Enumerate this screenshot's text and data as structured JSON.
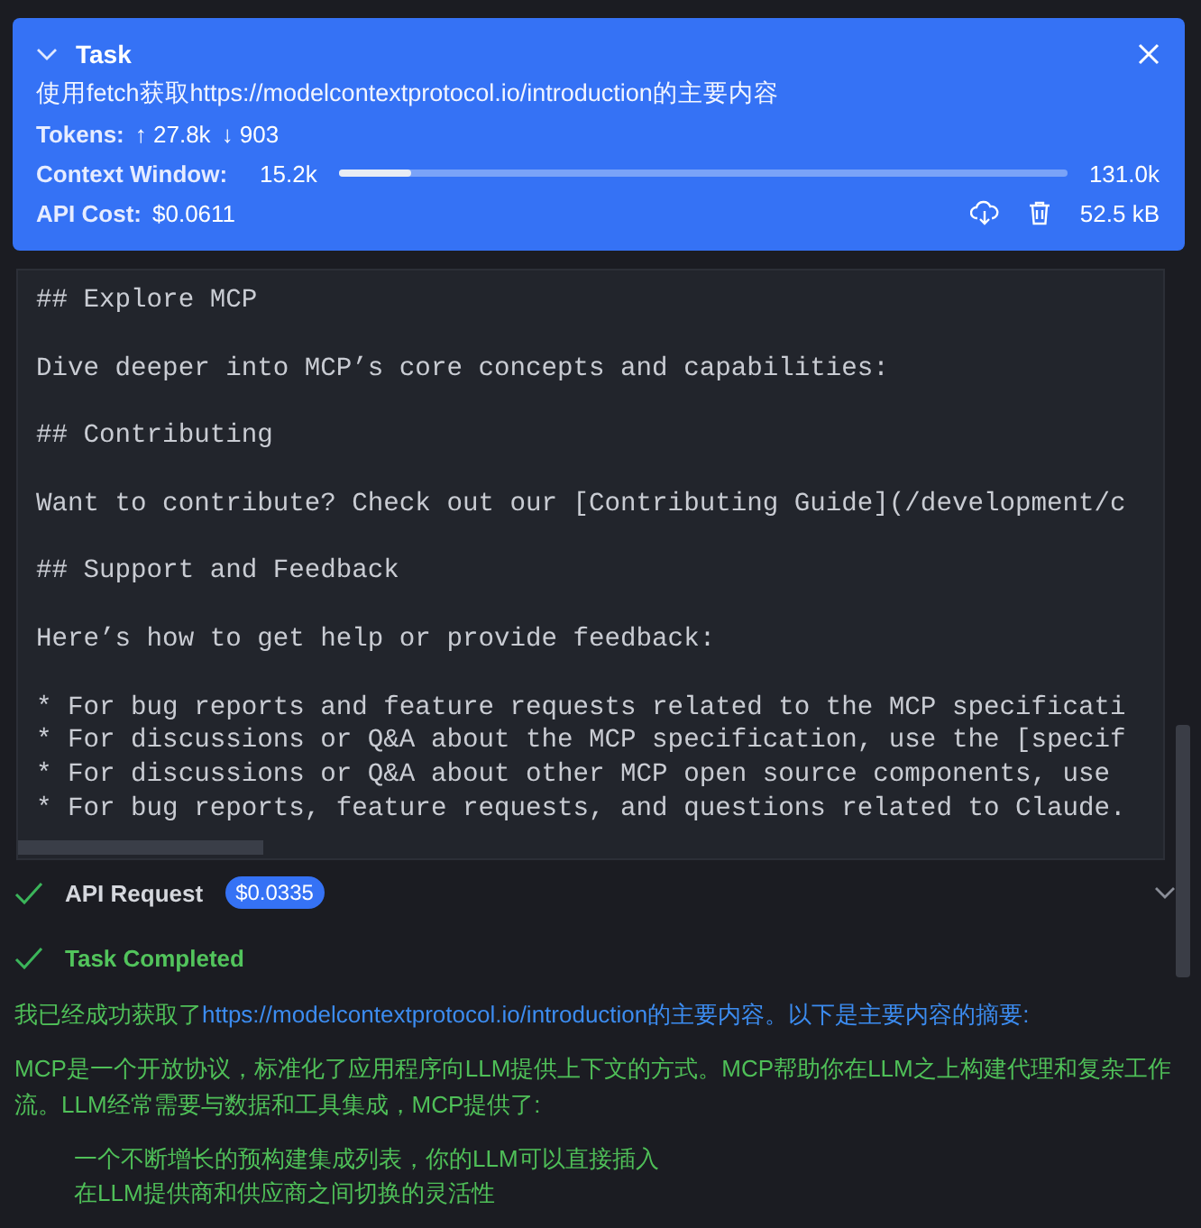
{
  "task": {
    "title": "Task",
    "expanded": true,
    "description": "使用fetch获取https://modelcontextprotocol.io/introduction的主要内容",
    "tokens": {
      "label": "Tokens:",
      "up": "↑ 27.8k",
      "down": "↓ 903"
    },
    "context_window": {
      "label": "Context Window:",
      "used": "15.2k",
      "level": 0.1,
      "total": "131.0k"
    },
    "api_cost": {
      "label": "API Cost:",
      "value": "$0.0611"
    },
    "size": "52.5 kB"
  },
  "code_block": {
    "paragraphs": [
      [
        "## Explore MCP"
      ],
      [
        "Dive deeper into MCP’s core concepts and capabilities:"
      ],
      [
        "## Contributing"
      ],
      [
        "Want to contribute? Check out our [Contributing Guide](/development/c"
      ],
      [
        "## Support and Feedback"
      ],
      [
        "Here’s how to get help or provide feedback:"
      ],
      [
        "* For bug reports and feature requests related to the MCP specificati",
        "* For discussions or Q&A about the MCP specification, use the [specif",
        "* For discussions or Q&A about other MCP open source components, use",
        "* For bug reports, feature requests, and questions related to Claude."
      ]
    ]
  },
  "api_request": {
    "label": "API Request",
    "cost": "$0.0335",
    "done": true,
    "expanded": false
  },
  "completion": {
    "label": "Task Completed",
    "done": true
  },
  "answer": {
    "intro": "我已经成功获取了",
    "link": "https://modelcontextprotocol.io/introduction",
    "intro_rest": "的主要内容。以下是主要内容的摘要:",
    "paragraph": "MCP是一个开放协议，标准化了应用程序向LLM提供上下文的方式。MCP帮助你在LLM之上构建代理和复杂工作流。LLM经常需要与数据和工具集成，MCP提供了:",
    "list": [
      "一个不断增长的预构建集成列表，你的LLM可以直接插入",
      "在LLM提供商和供应商之间切换的灵活性"
    ]
  }
}
